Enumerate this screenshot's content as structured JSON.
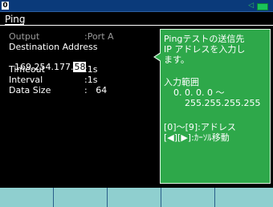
{
  "status_bar": {
    "channel_badge": "0"
  },
  "tab": {
    "label": "Ping"
  },
  "settings": {
    "output": {
      "label": "Output",
      "value": ":Port A"
    },
    "destination": {
      "label": "Destination Address",
      "ip_prefix": "169.254.177.",
      "ip_last": "58"
    },
    "timeout": {
      "label": "Timeout",
      "value": ":1s"
    },
    "interval": {
      "label": "Interval",
      "value": ":1s"
    },
    "data_size": {
      "label": "Data Size",
      "value": ":   64"
    }
  },
  "help_panel": {
    "line1": "Pingテストの送信先",
    "line2": "IP アドレスを入力し",
    "line3": "ます。",
    "range_title": "入力範囲",
    "range_from": "0. 0. 0. 0 ～",
    "range_to": "255.255.255.255",
    "hint1": "[0]～[9]:アドレス",
    "hint2": "[◀][▶]:ｶｰｿﾙ移動"
  },
  "function_keys": [
    "",
    "",
    "",
    "",
    ""
  ],
  "colors": {
    "help_bg": "#2ea84a",
    "fkey_bg": "#8fcfcf",
    "topbar_bg": "#0a3a7a"
  }
}
